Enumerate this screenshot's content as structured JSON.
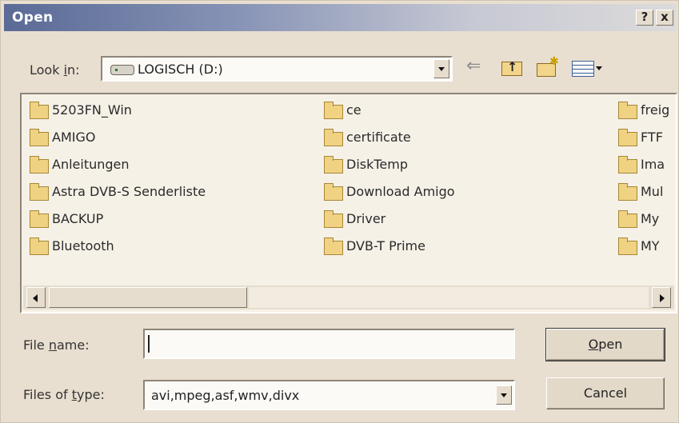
{
  "window": {
    "title": "Open",
    "help_label": "?",
    "close_label": "x"
  },
  "toolbar": {
    "look_in_label_pre": "Look ",
    "look_in_label_key": "i",
    "look_in_label_post": "n:",
    "look_in_value": "LOGISCH (D:)",
    "back_icon": "back-arrow-icon",
    "up_icon": "up-one-level-icon",
    "new_folder_icon": "new-folder-icon",
    "views_icon": "views-menu-icon"
  },
  "files": {
    "columns": [
      [
        "5203FN_Win",
        "AMIGO",
        "Anleitungen",
        "Astra DVB-S Senderliste",
        "BACKUP",
        "Bluetooth"
      ],
      [
        "ce",
        "certificate",
        "DiskTemp",
        "Download Amigo",
        "Driver",
        "DVB-T Prime"
      ],
      [
        "freig",
        "FTF",
        "Ima",
        "Mul",
        "My",
        "MY"
      ]
    ]
  },
  "form": {
    "file_name_label_pre": "File ",
    "file_name_label_key": "n",
    "file_name_label_post": "ame:",
    "file_name_value": "",
    "file_type_label_pre": "Files of ",
    "file_type_label_key": "t",
    "file_type_label_post": "ype:",
    "file_type_value": "avi,mpeg,asf,wmv,divx"
  },
  "buttons": {
    "open_key": "O",
    "open_rest": "pen",
    "cancel_label": "Cancel"
  },
  "colors": {
    "dialog_bg": "#e9dfd0",
    "title_gradient_start": "#5a6a96",
    "folder": "#f0d283"
  }
}
